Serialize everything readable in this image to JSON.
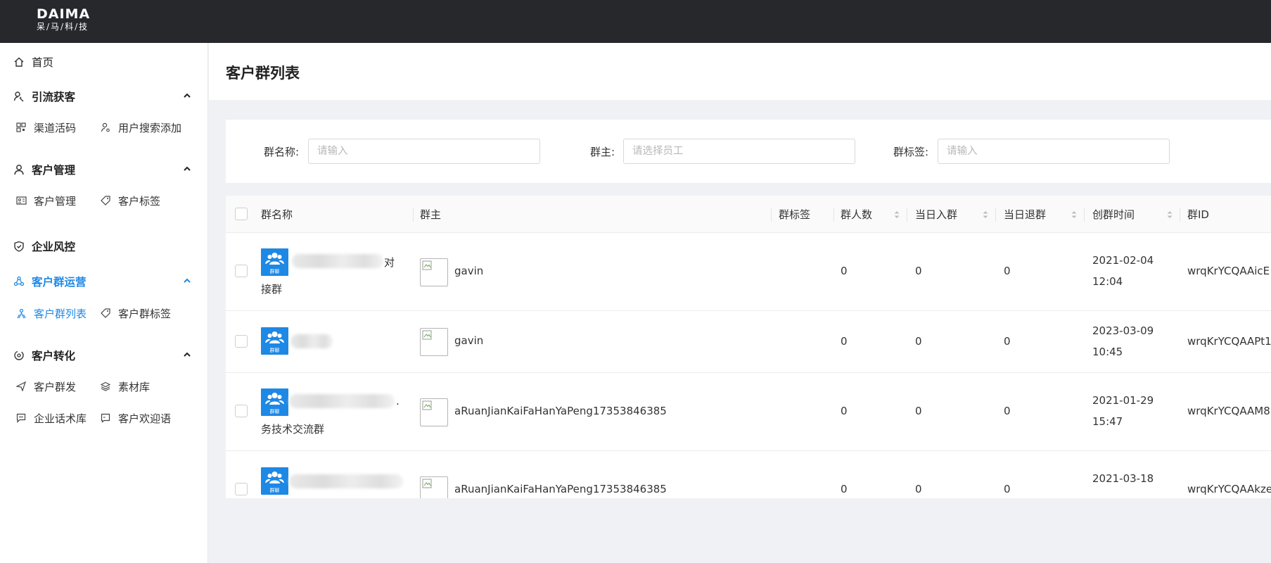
{
  "logo": {
    "main": "DAIMA",
    "sub": "呆/马/科/技"
  },
  "sidebar": {
    "home": {
      "label": "首页",
      "icon": "home-icon"
    },
    "groups": [
      {
        "label": "引流获客",
        "icon": "user-funnel-icon",
        "expanded": true,
        "items": [
          {
            "label": "渠道活码",
            "icon": "qrcode-icon"
          },
          {
            "label": "用户搜索添加",
            "icon": "user-search-icon"
          }
        ]
      },
      {
        "label": "客户管理",
        "icon": "user-icon",
        "expanded": true,
        "items": [
          {
            "label": "客户管理",
            "icon": "id-card-icon"
          },
          {
            "label": "客户标签",
            "icon": "tag-icon"
          }
        ]
      },
      {
        "label": "企业风控",
        "icon": "shield-icon"
      },
      {
        "label": "客户群运营",
        "icon": "group-icon",
        "expanded": true,
        "active": true,
        "items": [
          {
            "label": "客户群列表",
            "icon": "group-list-icon",
            "active": true
          },
          {
            "label": "客户群标签",
            "icon": "tag-icon"
          }
        ]
      },
      {
        "label": "客户转化",
        "icon": "convert-icon",
        "expanded": true,
        "items": [
          {
            "label": "客户群发",
            "icon": "send-icon"
          },
          {
            "label": "素材库",
            "icon": "layers-icon"
          },
          {
            "label": "企业话术库",
            "icon": "chat-icon"
          },
          {
            "label": "客户欢迎语",
            "icon": "welcome-icon"
          }
        ]
      }
    ]
  },
  "page": {
    "title": "客户群列表"
  },
  "filters": {
    "name": {
      "label": "群名称:",
      "placeholder": "请输入"
    },
    "owner": {
      "label": "群主:",
      "placeholder": "请选择员工"
    },
    "tag": {
      "label": "群标签:",
      "placeholder": "请输入"
    }
  },
  "table": {
    "columns": [
      "群名称",
      "群主",
      "群标签",
      "群人数",
      "当日入群",
      "当日退群",
      "创群时间",
      "群ID"
    ],
    "avatar_text": "群聊",
    "rows": [
      {
        "name_suffix": "对",
        "name_line2": "接群",
        "owner": "gavin",
        "tags": "",
        "members": "0",
        "joined_today": "0",
        "left_today": "0",
        "created_date": "2021-02-04",
        "created_time": "12:04",
        "group_id": "wrqKrYCQAAicE"
      },
      {
        "name_suffix": "",
        "name_line2": "",
        "owner": "gavin",
        "tags": "",
        "members": "0",
        "joined_today": "0",
        "left_today": "0",
        "created_date": "2023-03-09",
        "created_time": "10:45",
        "group_id": "wrqKrYCQAAPt1"
      },
      {
        "name_suffix": ".",
        "name_line2": "务技术交流群",
        "owner": "aRuanJianKaiFaHanYaPeng17353846385",
        "tags": "",
        "members": "0",
        "joined_today": "0",
        "left_today": "0",
        "created_date": "2021-01-29",
        "created_time": "15:47",
        "group_id": "wrqKrYCQAAM8"
      },
      {
        "name_suffix": "",
        "name_line2": "",
        "owner": "aRuanJianKaiFaHanYaPeng17353846385",
        "tags": "",
        "members": "0",
        "joined_today": "0",
        "left_today": "0",
        "created_date": "2021-03-18",
        "created_time": "",
        "group_id": "wrqKrYCQAAkze"
      }
    ]
  },
  "colors": {
    "topbar": "#27282c",
    "accent": "#1e88e5",
    "background": "#f0f1f5"
  }
}
